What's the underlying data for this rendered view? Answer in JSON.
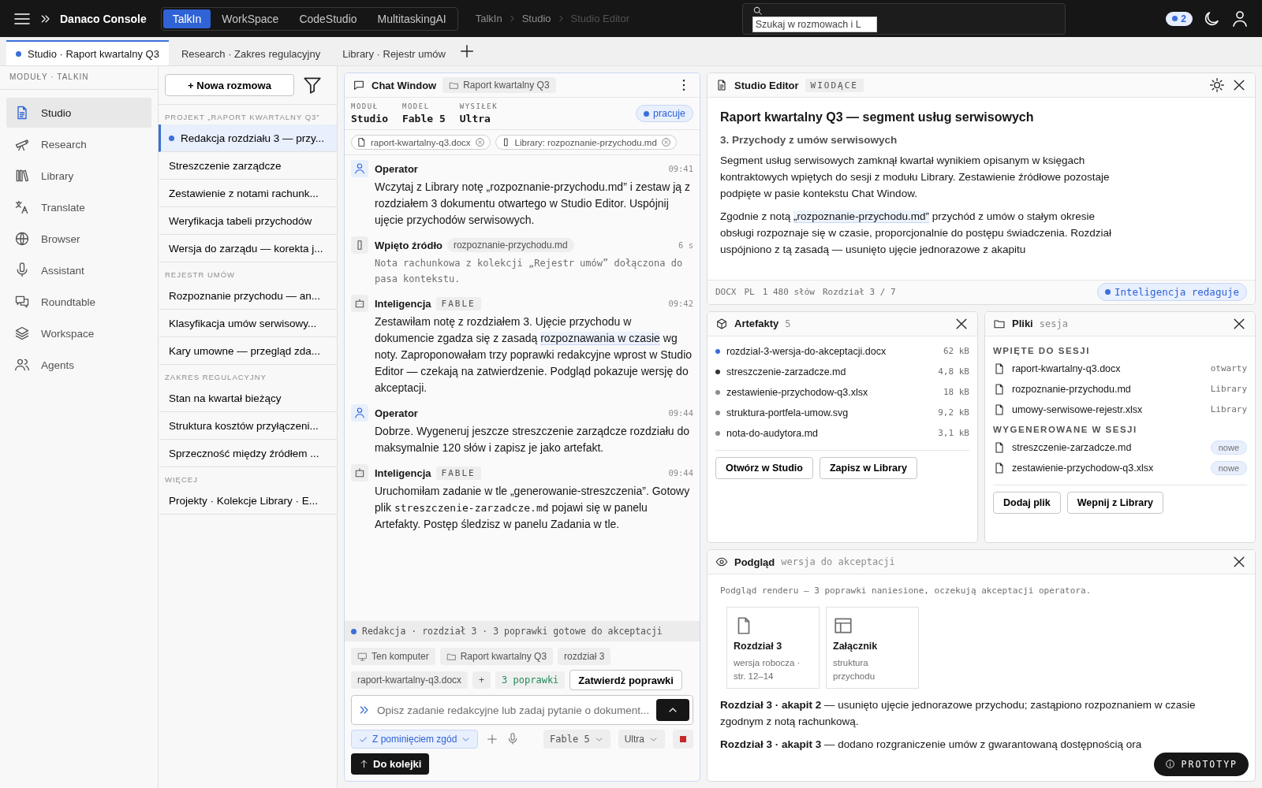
{
  "topbar": {
    "brand": "Danaco Console",
    "apps": [
      {
        "label": "TalkIn",
        "selected": true
      },
      {
        "label": "WorkSpace",
        "selected": false
      },
      {
        "label": "CodeStudio",
        "selected": false
      },
      {
        "label": "MultitaskingAI",
        "selected": false
      }
    ],
    "breadcrumb": [
      "TalkIn",
      "Studio",
      "Studio Editor"
    ],
    "search": {
      "placeholder": "Szukaj w rozmowach i L"
    },
    "notifications": "2"
  },
  "doc_tabs": [
    {
      "label": "Studio · Raport kwartalny Q3",
      "selected": true
    },
    {
      "label": "Research · Zakres regulacyjny",
      "selected": false
    },
    {
      "label": "Library · Rejestr umów",
      "selected": false
    }
  ],
  "modules": {
    "heading": "MODUŁY · TALKIN",
    "items": [
      {
        "label": "Studio",
        "selected": true
      },
      {
        "label": "Research",
        "selected": false
      },
      {
        "label": "Library",
        "selected": false
      },
      {
        "label": "Translate",
        "selected": false
      },
      {
        "label": "Browser",
        "selected": false
      },
      {
        "label": "Assistant",
        "selected": false
      },
      {
        "label": "Roundtable",
        "selected": false
      },
      {
        "label": "Workspace",
        "selected": false
      },
      {
        "label": "Agents",
        "selected": false
      }
    ]
  },
  "conversations": {
    "new_button": "+ Nowa rozmowa",
    "groups": [
      {
        "heading": "PROJEKT „RAPORT KWARTALNY Q3”",
        "items": [
          {
            "label": "Redakcja rozdziału 3 — przy...",
            "selected": true
          },
          {
            "label": "Streszczenie zarządcze",
            "selected": false
          },
          {
            "label": "Zestawienie z notami rachunk...",
            "selected": false
          },
          {
            "label": "Weryfikacja tabeli przychodów",
            "selected": false
          },
          {
            "label": "Wersja do zarządu — korekta j...",
            "selected": false
          }
        ]
      },
      {
        "heading": "REJESTR UMÓW",
        "items": [
          {
            "label": "Rozpoznanie przychodu — an...",
            "selected": false
          },
          {
            "label": "Klasyfikacja umów serwisowy...",
            "selected": false
          },
          {
            "label": "Kary umowne — przegląd zda...",
            "selected": false
          }
        ]
      },
      {
        "heading": "ZAKRES REGULACYJNY",
        "items": [
          {
            "label": "Stan na kwartał bieżący",
            "selected": false
          },
          {
            "label": "Struktura kosztów przyłączeni...",
            "selected": false
          },
          {
            "label": "Sprzeczność między źródłem ...",
            "selected": false
          }
        ]
      },
      {
        "heading": "WIĘCEJ",
        "items": [
          {
            "label": "Projekty · Kolekcje Library · E...",
            "selected": false
          }
        ]
      }
    ]
  },
  "chat": {
    "title": "Chat Window",
    "project": "Raport kwartalny Q3",
    "meta": [
      {
        "label": "MODUŁ",
        "value": "Studio"
      },
      {
        "label": "MODEL",
        "value": "Fable 5"
      },
      {
        "label": "WYSIŁEK",
        "value": "Ultra"
      }
    ],
    "status": "pracuje",
    "context": [
      {
        "kind": "file",
        "label": "raport-kwartalny-q3.docx"
      },
      {
        "kind": "pin",
        "label": "Library: rozpoznanie-przychodu.md"
      }
    ],
    "messages": [
      {
        "kind": "user",
        "author": "Operator",
        "time": "09:41",
        "parts": [
          {
            "kind": "text",
            "text": "Wczytaj z Library notę „rozpoznanie-przychodu.md” i zestaw ją z rozdziałem 3 dokumentu otwartego w Studio Editor. Uspójnij ujęcie przychodów serwisowych."
          }
        ]
      },
      {
        "kind": "source",
        "author": "Wpięto źródło",
        "tag": "rozpoznanie-przychodu.md",
        "time": "6 s",
        "parts": [
          {
            "kind": "text",
            "text": "Nota rachunkowa z kolekcji „Rejestr umów” dołączona do pasa kontekstu."
          }
        ]
      },
      {
        "kind": "ai",
        "author": "Inteligencja",
        "tag": "FABLE",
        "time": "09:42",
        "parts": [
          {
            "kind": "text",
            "text": "Zestawiłam notę z rozdziałem 3. Ujęcie przychodu w dokumencie zgadza się z zasadą "
          },
          {
            "kind": "mark",
            "text": "rozpoznawania w czasie"
          },
          {
            "kind": "text",
            "text": " wg noty. Zaproponowałam trzy poprawki redakcyjne wprost w Studio Editor — czekają na zatwierdzenie. Podgląd pokazuje wersję do akceptacji."
          }
        ]
      },
      {
        "kind": "user",
        "author": "Operator",
        "time": "09:44",
        "parts": [
          {
            "kind": "text",
            "text": "Dobrze. Wygeneruj jeszcze streszczenie zarządcze rozdziału do maksymalnie 120 słów i zapisz je jako artefakt."
          }
        ]
      },
      {
        "kind": "ai",
        "author": "Inteligencja",
        "tag": "FABLE",
        "time": "09:44",
        "parts": [
          {
            "kind": "text",
            "text": "Uruchomiłam zadanie w tle „generowanie-streszczenia”. Gotowy plik "
          },
          {
            "kind": "code",
            "text": "streszczenie-zarzadcze.md"
          },
          {
            "kind": "text",
            "text": " pojawi się w panelu Artefakty. Postęp śledzisz w panelu Zadania w tle."
          }
        ]
      }
    ],
    "activity": "Redakcja · rozdział 3 · 3 poprawki gotowe do akceptacji",
    "chips": [
      {
        "kind": "device",
        "label": "Ten komputer"
      },
      {
        "kind": "folder",
        "label": "Raport kwartalny Q3"
      },
      {
        "kind": "plain",
        "label": "rozdział 3"
      },
      {
        "kind": "plain",
        "label": "raport-kwartalny-q3.docx"
      },
      {
        "kind": "add",
        "label": "+"
      },
      {
        "kind": "count",
        "label": "3 poprawki"
      }
    ],
    "approve_button": "Zatwierdź poprawki",
    "composer": {
      "placeholder": "Opisz zadanie redakcyjne lub zadaj pytanie o dokument..."
    },
    "consent": {
      "label": "Z pominięciem zgód",
      "checked": true
    },
    "model_select": "Fable 5",
    "effort_select": "Ultra",
    "queue_button": "Do kolejki"
  },
  "editor": {
    "title": "Studio Editor",
    "badge": "WIODĄCE",
    "doc_title": "Raport kwartalny Q3 — segment usług serwisowych",
    "section": "3. Przychody z umów serwisowych",
    "paragraphs": [
      [
        {
          "kind": "text",
          "text": "Segment usług serwisowych zamknął kwartał wynikiem opisanym w księgach kontraktowych wpiętych do sesji z modułu Library. Zestawienie źródłowe pozostaje podpięte w pasie kontekstu Chat Window."
        }
      ],
      [
        {
          "kind": "text",
          "text": "Zgodnie z notą "
        },
        {
          "kind": "mark",
          "text": "„rozpoznanie-przychodu.md”"
        },
        {
          "kind": "text",
          "text": " przychód z umów o stałym okresie obsługi rozpoznaje się w czasie, proporcjonalnie do postępu świadczenia. Rozdział uspójniono z tą zasadą — usunięto ujęcie jednorazowe z akapitu"
        }
      ]
    ],
    "footer": [
      "DOCX",
      "PL",
      "1 480 słów",
      "Rozdział 3 / 7"
    ],
    "status": "Inteligencja redaguje"
  },
  "artifacts": {
    "title": "Artefakty",
    "count": "5",
    "items": [
      {
        "name": "rozdzial-3-wersja-do-akceptacji.docx",
        "size": "62 kB",
        "color": "#3b6fd8"
      },
      {
        "name": "streszczenie-zarzadcze.md",
        "size": "4,8 kB",
        "color": "#333333"
      },
      {
        "name": "zestawienie-przychodow-q3.xlsx",
        "size": "18 kB",
        "color": "#8d8d8d"
      },
      {
        "name": "struktura-portfela-umow.svg",
        "size": "9,2 kB",
        "color": "#8d8d8d"
      },
      {
        "name": "nota-do-audytora.md",
        "size": "3,1 kB",
        "color": "#8d8d8d"
      }
    ],
    "buttons": [
      "Otwórz w Studio",
      "Zapisz w Library"
    ]
  },
  "files": {
    "title": "Pliki",
    "subtitle": "sesja",
    "groups": [
      {
        "heading": "WPIĘTE DO SESJI",
        "items": [
          {
            "name": "raport-kwartalny-q3.docx",
            "tag": "otwarty",
            "kind": "plain"
          },
          {
            "name": "rozpoznanie-przychodu.md",
            "tag": "Library",
            "kind": "plain"
          },
          {
            "name": "umowy-serwisowe-rejestr.xlsx",
            "tag": "Library",
            "kind": "plain"
          }
        ]
      },
      {
        "heading": "WYGENEROWANE W SESJI",
        "items": [
          {
            "name": "streszczenie-zarzadcze.md",
            "tag": "nowe",
            "kind": "pill"
          },
          {
            "name": "zestawienie-przychodow-q3.xlsx",
            "tag": "nowe",
            "kind": "pill"
          }
        ]
      }
    ],
    "buttons": [
      "Dodaj plik",
      "Wepnij z Library"
    ]
  },
  "preview": {
    "title": "Podgląd",
    "subtitle": "wersja do akceptacji",
    "note": "Podgląd renderu — 3 poprawki naniesione, oczekują akceptacji operatora.",
    "cards": [
      {
        "kind": "document",
        "title": "Rozdział 3",
        "subtitle": "wersja robocza · str. 12–14"
      },
      {
        "kind": "table",
        "title": "Załącznik",
        "subtitle": "struktura przychodu"
      }
    ],
    "changes": [
      "**Rozdział 3 · akapit 2** — usunięto ujęcie jednorazowe przychodu; zastąpiono rozpoznaniem w czasie zgodnym z notą rachunkową.",
      "**Rozdział 3 · akapit 3** — dodano rozgraniczenie umów z gwarantowaną dostępnością ora"
    ]
  },
  "prototype_badge": "PROTOTYP"
}
